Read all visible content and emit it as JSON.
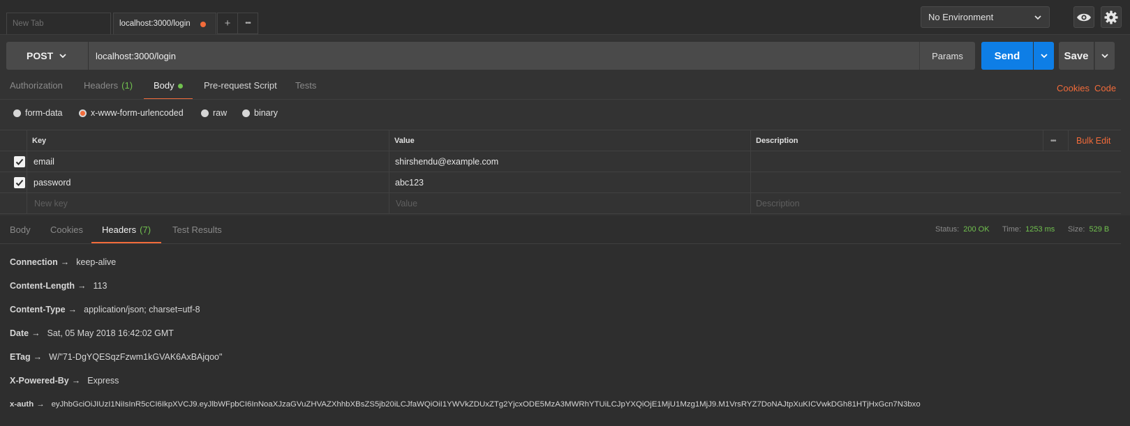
{
  "tabs": {
    "new_tab_placeholder": "New Tab",
    "active_label": "localhost:3000/login",
    "add_label": "+",
    "more_label": "•••"
  },
  "environment": {
    "selected": "No Environment"
  },
  "request": {
    "method": "POST",
    "url": "localhost:3000/login",
    "params_label": "Params",
    "send_label": "Send",
    "save_label": "Save"
  },
  "request_tabs": {
    "authorization": "Authorization",
    "headers": "Headers",
    "headers_count": "(1)",
    "body": "Body",
    "prerequest": "Pre-request Script",
    "tests": "Tests",
    "cookies_link": "Cookies",
    "code_link": "Code"
  },
  "body_modes": {
    "form_data": "form-data",
    "urlencoded": "x-www-form-urlencoded",
    "raw": "raw",
    "binary": "binary",
    "selected": "x-www-form-urlencoded"
  },
  "params_table": {
    "columns": {
      "key": "Key",
      "value": "Value",
      "description": "Description"
    },
    "more_label": "•••",
    "bulk_edit": "Bulk Edit",
    "rows": [
      {
        "key": "email",
        "value": "shirshendu@example.com",
        "description": "",
        "checked": true
      },
      {
        "key": "password",
        "value": "abc123",
        "description": "",
        "checked": true
      }
    ],
    "placeholders": {
      "key": "New key",
      "value": "Value",
      "description": "Description"
    }
  },
  "response": {
    "tabs": {
      "body": "Body",
      "cookies": "Cookies",
      "headers": "Headers",
      "headers_count": "(7)",
      "test_results": "Test Results"
    },
    "status_label": "Status:",
    "status_value": "200 OK",
    "time_label": "Time:",
    "time_value": "1253 ms",
    "size_label": "Size:",
    "size_value": "529 B",
    "headers": [
      {
        "key": "Connection",
        "value": "keep-alive"
      },
      {
        "key": "Content-Length",
        "value": "113"
      },
      {
        "key": "Content-Type",
        "value": "application/json; charset=utf-8"
      },
      {
        "key": "Date",
        "value": "Sat, 05 May 2018 16:42:02 GMT"
      },
      {
        "key": "ETag",
        "value": "W/\"71-DgYQESqzFzwm1kGVAK6AxBAjqoo\""
      },
      {
        "key": "X-Powered-By",
        "value": "Express"
      },
      {
        "key": "x-auth",
        "value": "eyJhbGciOiJIUzI1NiIsInR5cCI6IkpXVCJ9.eyJlbWFpbCI6InNoaXJzaGVuZHVAZXhhbXBsZS5jb20iLCJfaWQiOiI1YWVkZDUxZTg2YjcxODE5MzA3MWRhYTUiLCJpYXQiOjE1MjU1Mzg1MjJ9.M1VrsRYZ7DoNAJtpXuKICVwkDGh81HTjHxGcn7N3bxo"
      }
    ],
    "arrow": "→"
  },
  "colors": {
    "accent_orange": "#f26b3a",
    "send_blue": "#0e7ee6",
    "status_green": "#71c14f",
    "background": "#333333"
  },
  "icons": [
    "chevron-down-icon",
    "eye-icon",
    "gear-icon",
    "checkmark-icon",
    "dirty-dot-icon"
  ]
}
